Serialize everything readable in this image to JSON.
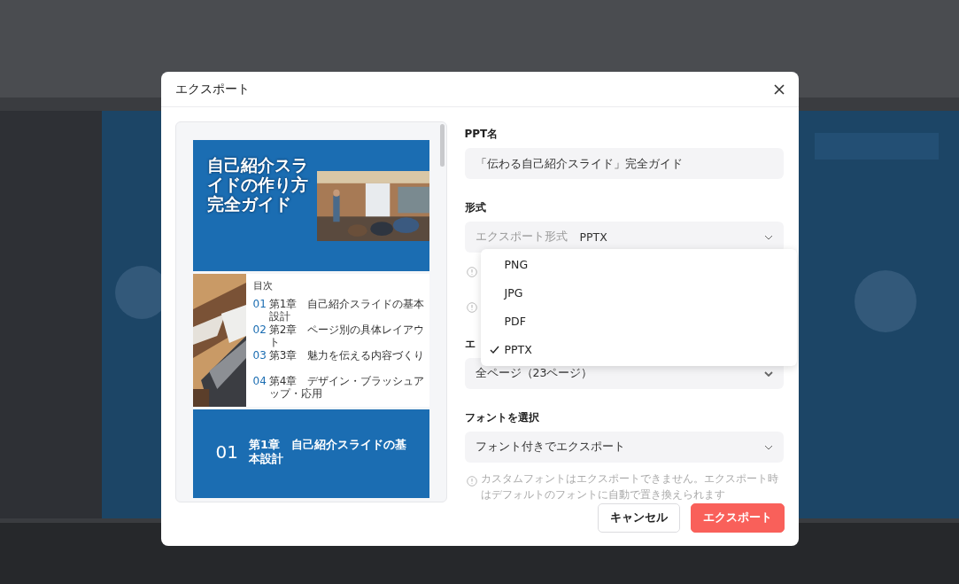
{
  "dialog": {
    "title": "エクスポート"
  },
  "preview": {
    "slides": [
      {
        "kind": "title",
        "heading": "自己紹介スライドの作り方完全ガイド"
      },
      {
        "kind": "toc",
        "heading": "目次",
        "items": [
          {
            "number": "01",
            "text": "第1章　自己紹介スライドの基本設計"
          },
          {
            "number": "02",
            "text": "第2章　ページ別の具体レイアウト"
          },
          {
            "number": "03",
            "text": "第3章　魅力を伝える内容づくり"
          },
          {
            "number": "04",
            "text": "第4章　デザイン・ブラッシュアップ・応用"
          }
        ]
      },
      {
        "kind": "section",
        "number": "01",
        "heading": "第1章　自己紹介スライドの基本設計"
      }
    ]
  },
  "form": {
    "name": {
      "label": "PPT名",
      "value": "「伝わる自己紹介スライド」完全ガイド"
    },
    "format": {
      "label": "形式",
      "prefix": "エクスポート形式",
      "value": "PPTX"
    },
    "range": {
      "label": "エ",
      "value": "全ページ（23ページ）"
    },
    "font": {
      "label": "フォントを選択",
      "value": "フォント付きでエクスポート",
      "note": "カスタムフォントはエクスポートできません。エクスポート時はデフォルトのフォントに自動で置き換えられます"
    }
  },
  "format_menu": [
    {
      "label": "PNG",
      "selected": false
    },
    {
      "label": "JPG",
      "selected": false
    },
    {
      "label": "PDF",
      "selected": false
    },
    {
      "label": "PPTX",
      "selected": true
    }
  ],
  "buttons": [
    {
      "label": "キャンセル",
      "kind": "secondary"
    },
    {
      "label": "エクスポート",
      "kind": "primary"
    }
  ]
}
